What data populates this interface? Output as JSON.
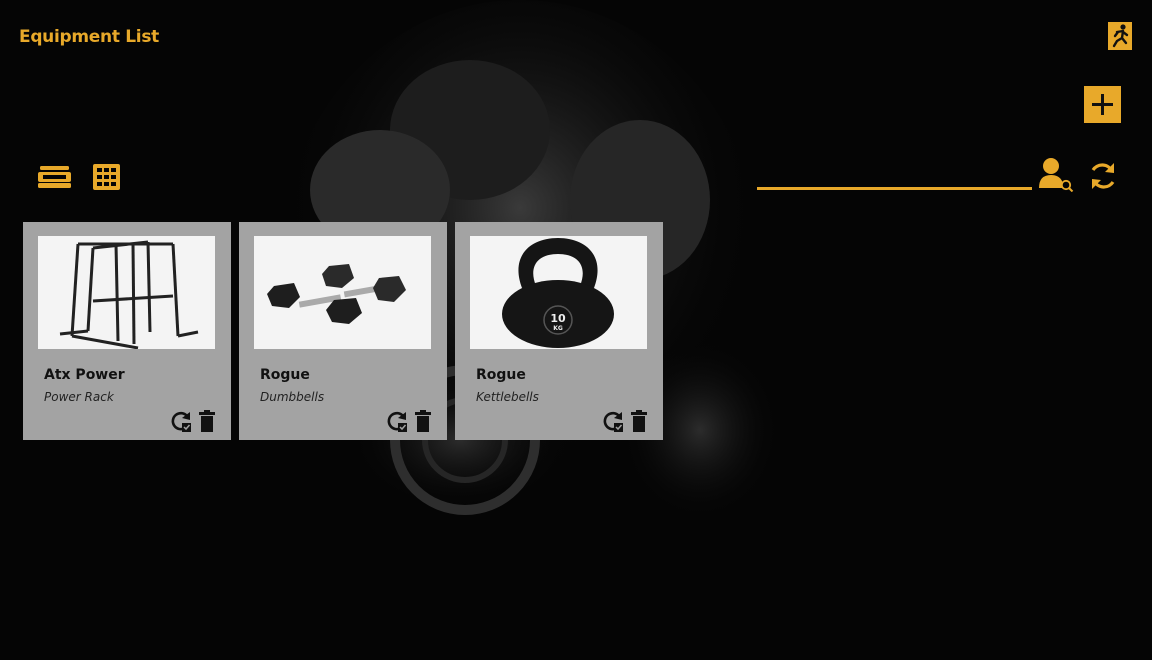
{
  "header": {
    "title": "Equipment List"
  },
  "toolbar": {
    "exit_icon": "running-man-exit-icon",
    "add_icon": "plus-icon",
    "list_view_icon": "list-view-icon",
    "grid_view_icon": "grid-view-icon",
    "filter_user_icon": "user-search-icon",
    "refresh_icon": "refresh-icon"
  },
  "search": {
    "value": "",
    "placeholder": ""
  },
  "colors": {
    "accent": "#e8a92a",
    "card_bg": "#a3a3a3",
    "background": "#050505"
  },
  "equipment": [
    {
      "name": "Atx Power",
      "type": "Power Rack",
      "image": "power-rack"
    },
    {
      "name": "Rogue",
      "type": "Dumbbells",
      "image": "dumbbells"
    },
    {
      "name": "Rogue",
      "type": "Kettlebells",
      "image": "kettlebell",
      "image_text_value": "10",
      "image_text_unit": "KG"
    }
  ]
}
